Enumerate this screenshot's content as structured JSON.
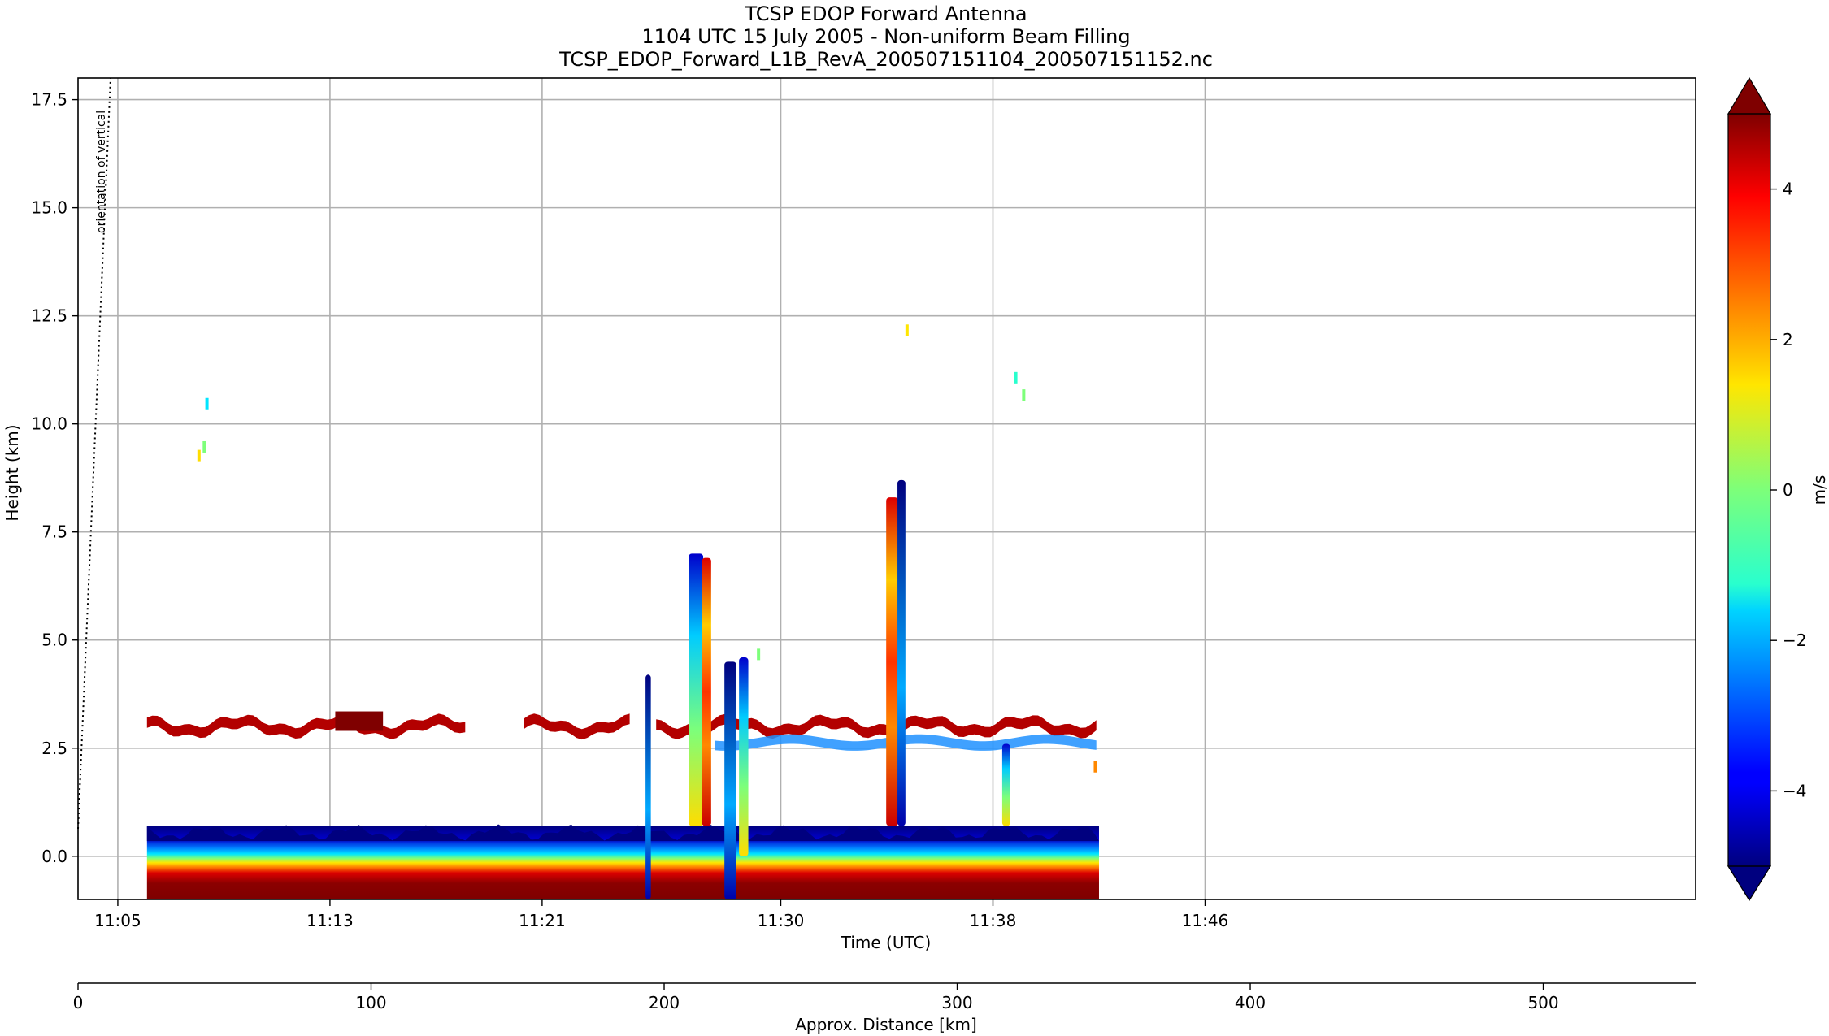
{
  "chart_data": {
    "type": "heatmap",
    "title": "TCSP EDOP Forward Antenna",
    "subtitle": "1104 UTC 15 July 2005 - Non-uniform Beam Filling",
    "filename": "TCSP_EDOP_Forward_L1B_RevA_200507151104_200507151152.nc",
    "xlabel": "Time (UTC)",
    "ylabel": "Height (km)",
    "x2label": "Approx. Distance [km]",
    "colorbar_label": "m/s",
    "annotation": "orientation of vertical",
    "x_ticks": [
      "11:05",
      "11:13",
      "11:21",
      "11:30",
      "11:38",
      "11:46"
    ],
    "y_ticks": [
      "0.0",
      "2.5",
      "5.0",
      "7.5",
      "10.0",
      "12.5",
      "15.0",
      "17.5"
    ],
    "distance_ticks": [
      "0",
      "100",
      "200",
      "300",
      "400",
      "500"
    ],
    "colorbar_ticks": [
      "4",
      "2",
      "0",
      "−2",
      "−4"
    ],
    "ylim": [
      -1.0,
      18.0
    ],
    "xlim_minutes": [
      -1.5,
      59.5
    ],
    "distance_range_km": [
      0,
      552
    ],
    "colorbar_range": [
      -5,
      5
    ],
    "colormap": "jet",
    "grid": true,
    "data_end_time": "11:37",
    "features": [
      {
        "name": "melting-layer band",
        "time_min": [
          1.1,
          37.0
        ],
        "height_km": [
          2.5,
          3.3
        ],
        "velocity_ms": 4.5
      },
      {
        "name": "surface return",
        "time_min": [
          1.1,
          37.0
        ],
        "height_km": [
          -1.0,
          0.7
        ],
        "velocity_ms": [
          -5,
          5
        ]
      },
      {
        "name": "convective cell",
        "time_min": 22.5,
        "height_km": [
          0.7,
          7.0
        ]
      },
      {
        "name": "convective cell",
        "time_min": 23.4,
        "height_km": [
          0,
          4.6
        ]
      },
      {
        "name": "convective cell",
        "time_min": 29.5,
        "height_km": [
          0.7,
          8.7
        ]
      },
      {
        "name": "convective cell",
        "time_min": 33.6,
        "height_km": [
          0.7,
          4.0
        ]
      },
      {
        "name": "convective cell",
        "time_min": 20.0,
        "height_km": [
          0,
          4.2
        ]
      }
    ]
  }
}
